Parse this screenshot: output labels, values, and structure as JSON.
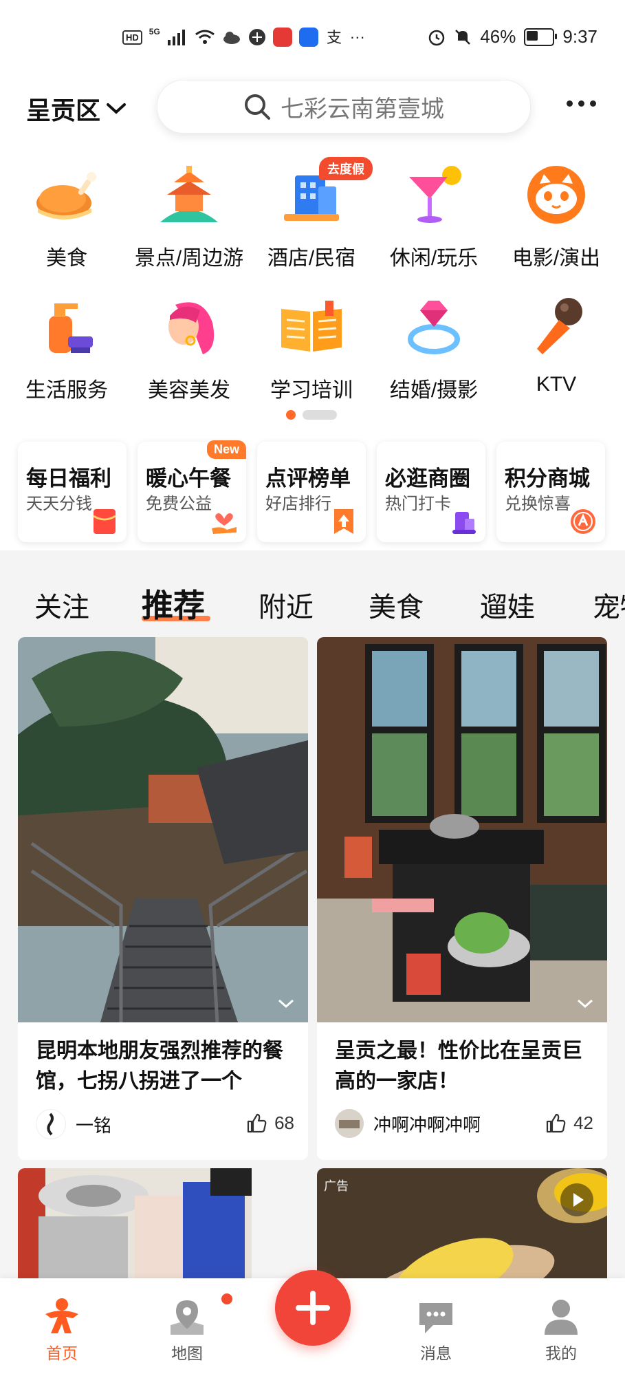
{
  "status_bar": {
    "network": "HD",
    "gen": "5G",
    "battery_percent": "46%",
    "time": "9:37",
    "ellipsis": "···"
  },
  "header": {
    "district": "呈贡区",
    "search_placeholder": "七彩云南第壹城"
  },
  "categories": [
    {
      "label": "美食",
      "icon": "roast-chicken-icon"
    },
    {
      "label": "景点/周边游",
      "icon": "pavilion-icon"
    },
    {
      "label": "酒店/民宿",
      "icon": "hotel-icon",
      "badge": "去度假"
    },
    {
      "label": "休闲/玩乐",
      "icon": "cocktail-icon"
    },
    {
      "label": "电影/演出",
      "icon": "cat-face-icon"
    },
    {
      "label": "生活服务",
      "icon": "cleaning-spray-icon"
    },
    {
      "label": "美容美发",
      "icon": "woman-hair-icon"
    },
    {
      "label": "学习培训",
      "icon": "open-book-icon"
    },
    {
      "label": "结婚/摄影",
      "icon": "diamond-ring-icon"
    },
    {
      "label": "KTV",
      "icon": "microphone-icon"
    }
  ],
  "pager": {
    "current": 1,
    "total": 2
  },
  "promos": [
    {
      "title": "每日福利",
      "subtitle": "天天分钱",
      "icon": "red-envelope-icon"
    },
    {
      "title": "暖心午餐",
      "subtitle": "免费公益",
      "icon": "heart-hand-icon",
      "badge": "New"
    },
    {
      "title": "点评榜单",
      "subtitle": "好店排行",
      "icon": "ranking-flag-icon"
    },
    {
      "title": "必逛商圈",
      "subtitle": "热门打卡",
      "icon": "building-icon"
    },
    {
      "title": "积分商城",
      "subtitle": "兑换惊喜",
      "icon": "points-icon"
    }
  ],
  "tabs": [
    {
      "label": "关注"
    },
    {
      "label": "推荐",
      "active": true
    },
    {
      "label": "附近"
    },
    {
      "label": "美食"
    },
    {
      "label": "遛娃"
    },
    {
      "label": "宠物"
    }
  ],
  "feed": [
    {
      "title": "昆明本地朋友强烈推荐的餐馆，七拐八拐进了一个",
      "author": "一铭",
      "likes": "68"
    },
    {
      "title": "呈贡之最！性价比在呈贡巨高的一家店！",
      "author": "冲啊冲啊冲啊",
      "likes": "42"
    },
    {
      "title": "",
      "author": "",
      "likes": ""
    },
    {
      "title": "",
      "author": "",
      "likes": "",
      "ad_label": "广告"
    }
  ],
  "bottom_nav": [
    {
      "label": "首页",
      "icon": "home-runner-icon",
      "active": true
    },
    {
      "label": "地图",
      "icon": "map-pin-icon"
    },
    {
      "label": "",
      "icon": "plus-icon"
    },
    {
      "label": "消息",
      "icon": "message-icon"
    },
    {
      "label": "我的",
      "icon": "profile-icon"
    }
  ],
  "colors": {
    "accent": "#ff6a2b",
    "badge_red": "#f24b2e",
    "fab": "#f2453a"
  }
}
